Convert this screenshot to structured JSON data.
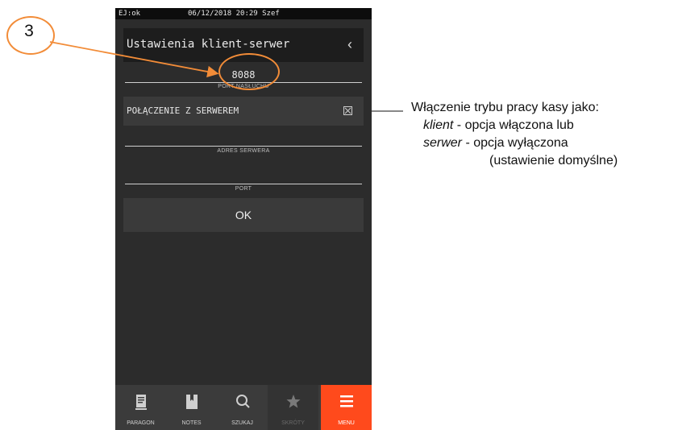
{
  "statusbar": {
    "left": "EJ:ok",
    "center": "06/12/2018 20:29 Szef"
  },
  "header": {
    "title": "Ustawienia klient-serwer",
    "back_icon": "chevron-left-icon"
  },
  "fields": {
    "listen_port_value": "8088",
    "listen_port_label": "PORT NASŁUCHU",
    "server_address_value": "",
    "server_address_label": "ADRES SERWERA",
    "port_value": "",
    "port_label": "PORT"
  },
  "toggle": {
    "label": "POŁĄCZENIE Z SERWEREM",
    "checked": false
  },
  "ok_label": "OK",
  "nav": [
    {
      "label": "PARAGON",
      "icon": "receipt-icon"
    },
    {
      "label": "NOTES",
      "icon": "notes-icon"
    },
    {
      "label": "SZUKAJ",
      "icon": "search-icon"
    },
    {
      "label": "SKRÓTY",
      "icon": "star-icon"
    },
    {
      "label": "MENU",
      "icon": "menu-icon"
    }
  ],
  "annotation": {
    "number": "3",
    "note_line1": "Włączenie trybu pracy kasy jako:",
    "note_l2_em": "klient",
    "note_l2_rest": " - opcja włączona  lub",
    "note_l3_em": "serwer",
    "note_l3_rest": " - opcja wyłączona",
    "note_line4": "(ustawienie domyślne)",
    "accent_color": "#f28c38"
  },
  "colors": {
    "screen_bg": "#2c2c2c",
    "menu_active": "#ff4a1c"
  }
}
